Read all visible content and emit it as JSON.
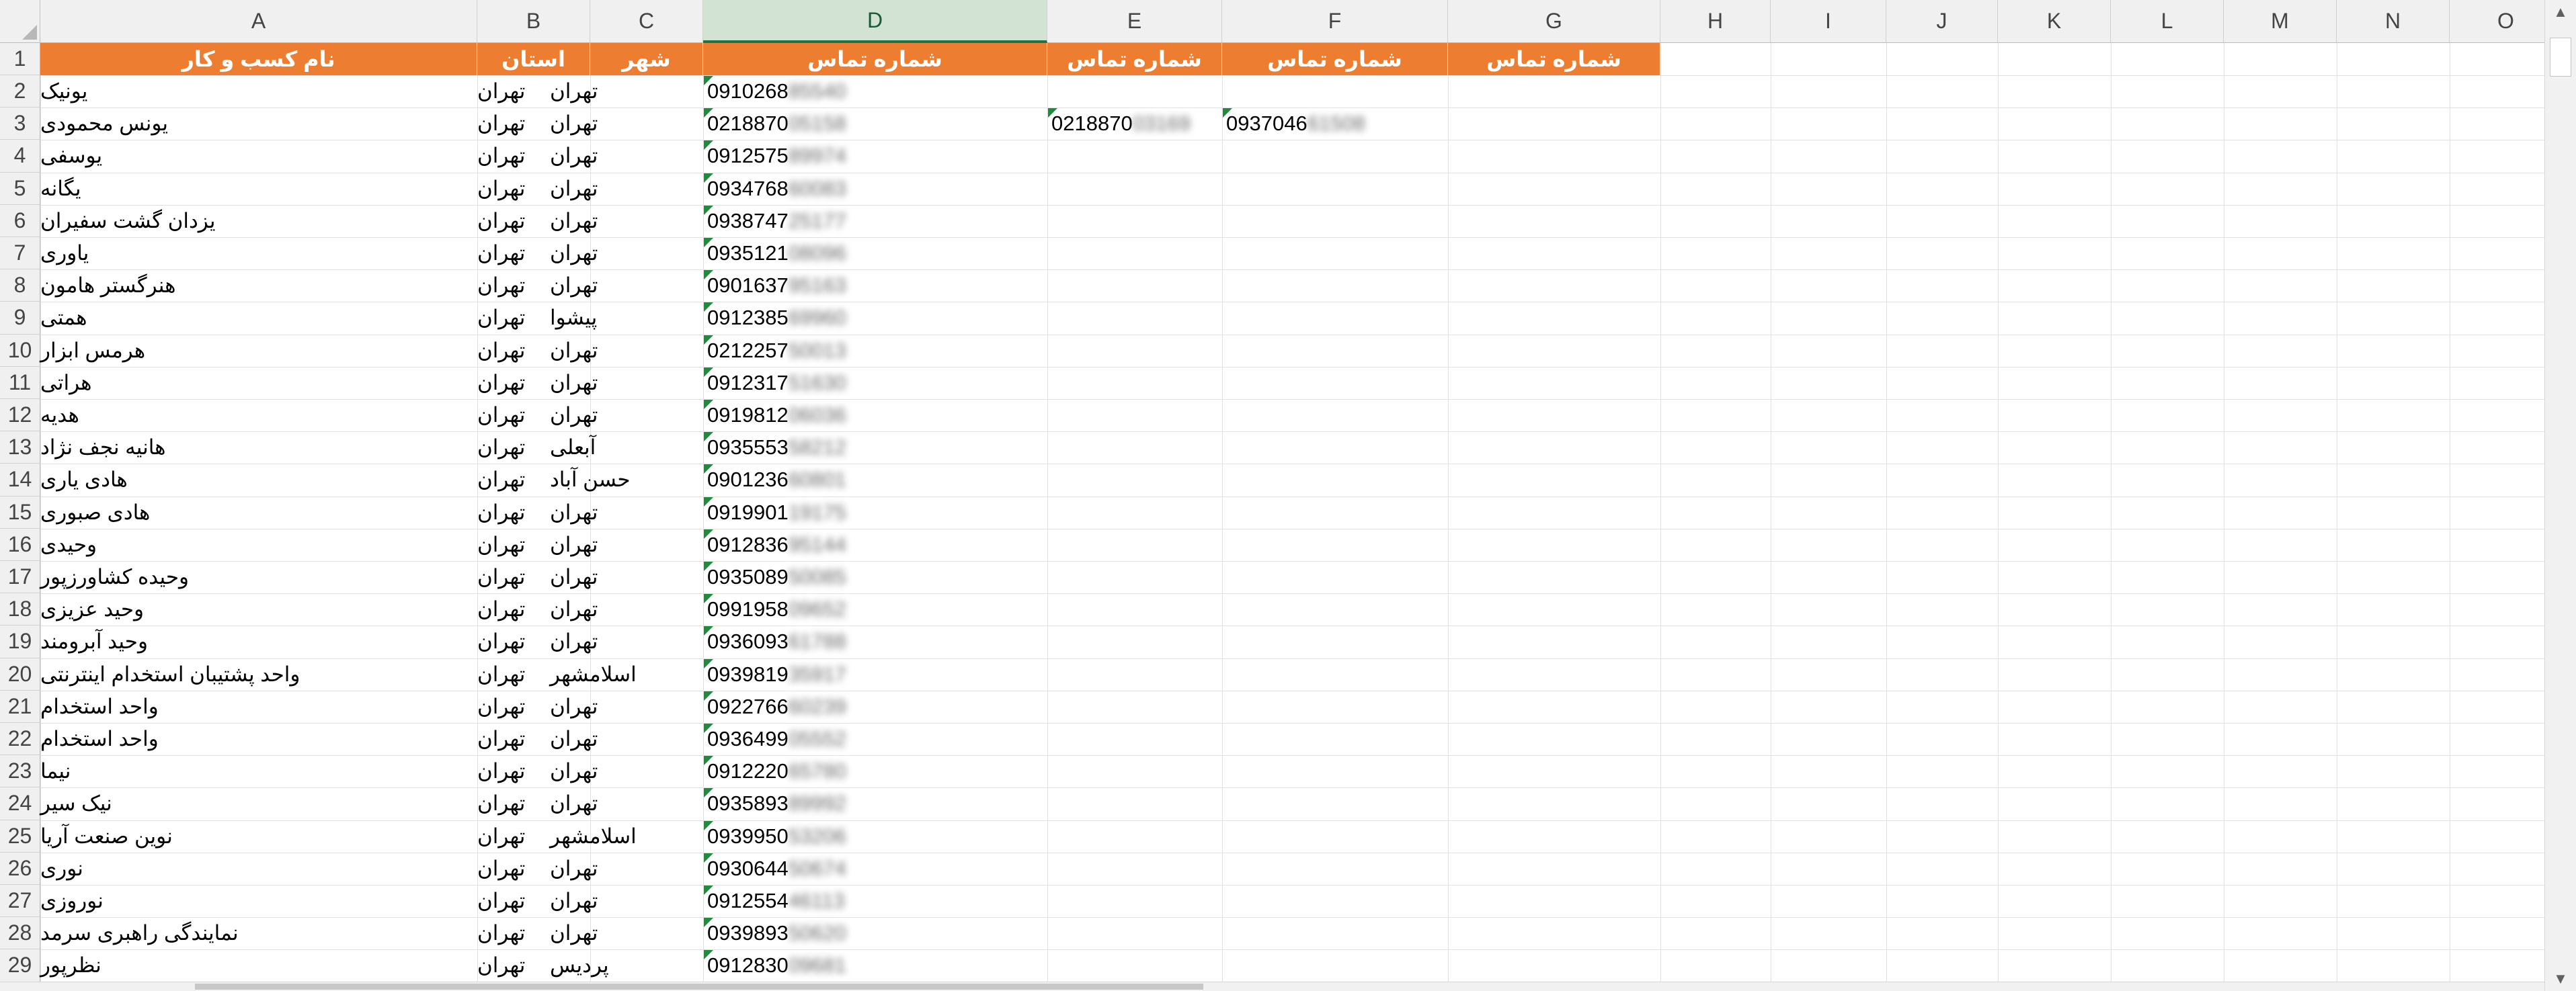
{
  "column_headers": [
    "A",
    "B",
    "C",
    "D",
    "E",
    "F",
    "G",
    "H",
    "I",
    "J",
    "K",
    "L",
    "M",
    "N",
    "O"
  ],
  "header_row": {
    "A": "نام کسب و کار",
    "B": "استان",
    "C": "شهر",
    "D": "شماره تماس",
    "E": "شماره تماس",
    "F": "شماره تماس",
    "G": "شماره تماس"
  },
  "rows": [
    {
      "num": "2",
      "name": "یونیک",
      "province": "تهران",
      "city": "تهران",
      "phone": "0910268",
      "phone_hidden": "85540"
    },
    {
      "num": "3",
      "name": "یونس محمودی",
      "province": "تهران",
      "city": "تهران",
      "phone": "0218870",
      "phone_hidden": "05158",
      "phone2": "0218870",
      "phone2_hidden": "03169",
      "phone3": "0937046",
      "phone3_hidden": "61508"
    },
    {
      "num": "4",
      "name": "یوسفی",
      "province": "تهران",
      "city": "تهران",
      "phone": "0912575",
      "phone_hidden": "89974"
    },
    {
      "num": "5",
      "name": "یگانه",
      "province": "تهران",
      "city": "تهران",
      "phone": "0934768",
      "phone_hidden": "60083"
    },
    {
      "num": "6",
      "name": "یزدان گشت سفیران",
      "province": "تهران",
      "city": "تهران",
      "phone": "0938747",
      "phone_hidden": "25177"
    },
    {
      "num": "7",
      "name": "یاوری",
      "province": "تهران",
      "city": "تهران",
      "phone": "0935121",
      "phone_hidden": "08096"
    },
    {
      "num": "8",
      "name": "هنرگستر هامون",
      "province": "تهران",
      "city": "تهران",
      "phone": "0901637",
      "phone_hidden": "95163"
    },
    {
      "num": "9",
      "name": "همتی",
      "province": "تهران",
      "city": "پیشوا",
      "phone": "0912385",
      "phone_hidden": "69960"
    },
    {
      "num": "10",
      "name": "هرمس ابزار",
      "province": "تهران",
      "city": "تهران",
      "phone": "0212257",
      "phone_hidden": "50013"
    },
    {
      "num": "11",
      "name": "هراتی",
      "province": "تهران",
      "city": "تهران",
      "phone": "0912317",
      "phone_hidden": "51630"
    },
    {
      "num": "12",
      "name": "هدیه",
      "province": "تهران",
      "city": "تهران",
      "phone": "0919812",
      "phone_hidden": "06036"
    },
    {
      "num": "13",
      "name": "هانیه نجف نژاد",
      "province": "تهران",
      "city": "آبعلی",
      "phone": "0935553",
      "phone_hidden": "58212"
    },
    {
      "num": "14",
      "name": "هادی یاری",
      "province": "تهران",
      "city": "حسن آباد",
      "phone": "0901236",
      "phone_hidden": "60801"
    },
    {
      "num": "15",
      "name": "هادی صبوری",
      "province": "تهران",
      "city": "تهران",
      "phone": "0919901",
      "phone_hidden": "19175"
    },
    {
      "num": "16",
      "name": "وحیدی",
      "province": "تهران",
      "city": "تهران",
      "phone": "0912836",
      "phone_hidden": "95144"
    },
    {
      "num": "17",
      "name": "وحیده کشاورزپور",
      "province": "تهران",
      "city": "تهران",
      "phone": "0935089",
      "phone_hidden": "50085"
    },
    {
      "num": "18",
      "name": "وحید عزیزی",
      "province": "تهران",
      "city": "تهران",
      "phone": "0991958",
      "phone_hidden": "09652"
    },
    {
      "num": "19",
      "name": "وحید آبرومند",
      "province": "تهران",
      "city": "تهران",
      "phone": "0936093",
      "phone_hidden": "61788"
    },
    {
      "num": "20",
      "name": "واحد پشتیبان استخدام اینترنتی",
      "province": "تهران",
      "city": "اسلامشهر",
      "phone": "0939819",
      "phone_hidden": "35917"
    },
    {
      "num": "21",
      "name": "واحد استخدام",
      "province": "تهران",
      "city": "تهران",
      "phone": "0922766",
      "phone_hidden": "60239"
    },
    {
      "num": "22",
      "name": "واحد استخدام",
      "province": "تهران",
      "city": "تهران",
      "phone": "0936499",
      "phone_hidden": "05552"
    },
    {
      "num": "23",
      "name": "نیما",
      "province": "تهران",
      "city": "تهران",
      "phone": "0912220",
      "phone_hidden": "65780"
    },
    {
      "num": "24",
      "name": "نیک سیر",
      "province": "تهران",
      "city": "تهران",
      "phone": "0935893",
      "phone_hidden": "89992"
    },
    {
      "num": "25",
      "name": "نوین صنعت آریا",
      "province": "تهران",
      "city": "اسلامشهر",
      "phone": "0939950",
      "phone_hidden": "53206"
    },
    {
      "num": "26",
      "name": "نوری",
      "province": "تهران",
      "city": "تهران",
      "phone": "0930644",
      "phone_hidden": "50674"
    },
    {
      "num": "27",
      "name": "نوروزی",
      "province": "تهران",
      "city": "تهران",
      "phone": "0912554",
      "phone_hidden": "46113"
    },
    {
      "num": "28",
      "name": "نمایندگی راهبری سرمد",
      "province": "تهران",
      "city": "تهران",
      "phone": "0939893",
      "phone_hidden": "50620"
    },
    {
      "num": "29",
      "name": "نظرپور",
      "province": "تهران",
      "city": "پردیس",
      "phone": "0912830",
      "phone_hidden": "09681"
    }
  ],
  "row1_label": "1",
  "scroll": {
    "up_icon": "▲",
    "down_icon": "▼"
  },
  "colors": {
    "header_fill": "#ed7d31",
    "selected_column": "#217346",
    "grid": "#e1e1e1",
    "comment_marker": "#1e8c3a"
  }
}
